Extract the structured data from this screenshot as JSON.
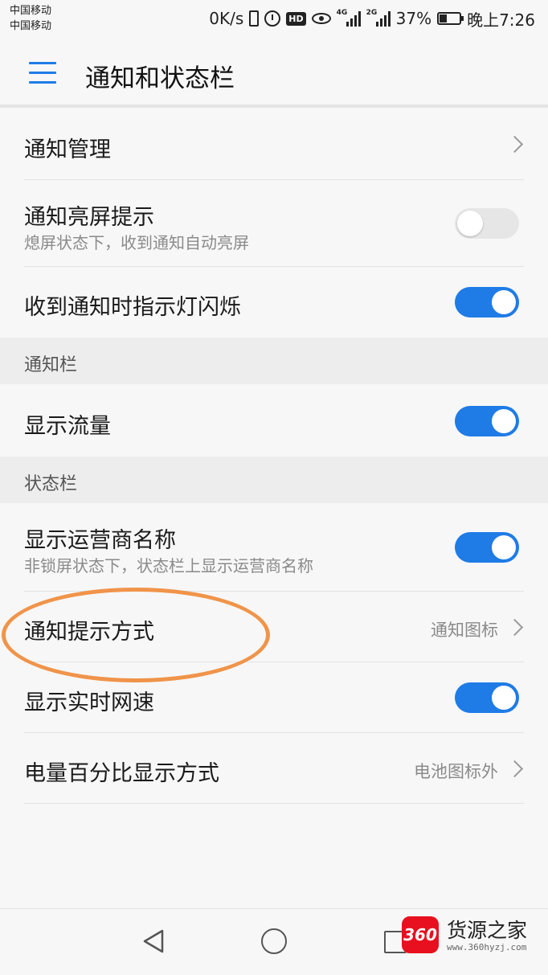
{
  "status_bar": {
    "carrier_1": "中国移动",
    "carrier_2": "中国移动",
    "speed": "0K/s",
    "hd": "HD",
    "net_1": "4G",
    "net_2": "2G",
    "battery": "37%",
    "time": "晚上7:26"
  },
  "app_bar": {
    "title": "通知和状态栏",
    "menu_icon": "hamburger-menu-icon",
    "accent": "#1f7be6"
  },
  "rows": {
    "notification_management": {
      "title": "通知管理"
    },
    "wake_screen": {
      "title": "通知亮屏提示",
      "subtitle": "熄屏状态下，收到通知自动亮屏",
      "toggle": "off"
    },
    "indicator_light": {
      "title": "收到通知时指示灯闪烁",
      "toggle": "on"
    },
    "show_traffic": {
      "title": "显示流量",
      "toggle": "on"
    },
    "carrier_name": {
      "title": "显示运营商名称",
      "subtitle": "非锁屏状态下，状态栏上显示运营商名称",
      "toggle": "on"
    },
    "notify_method": {
      "title": "通知提示方式",
      "value": "通知图标"
    },
    "realtime_speed": {
      "title": "显示实时网速",
      "toggle": "on"
    },
    "battery_percent": {
      "title": "电量百分比显示方式",
      "value": "电池图标外"
    }
  },
  "sections": {
    "notification_bar": "通知栏",
    "status_bar": "状态栏"
  },
  "annotation": {
    "color": "#f0944a"
  },
  "nav_bar": {
    "icons": [
      "back-icon",
      "home-icon",
      "recent-apps-icon"
    ]
  },
  "watermark": {
    "badge": "360",
    "name": "货源之家",
    "url": "www.360hyzj.com",
    "color": "#e8101e"
  }
}
